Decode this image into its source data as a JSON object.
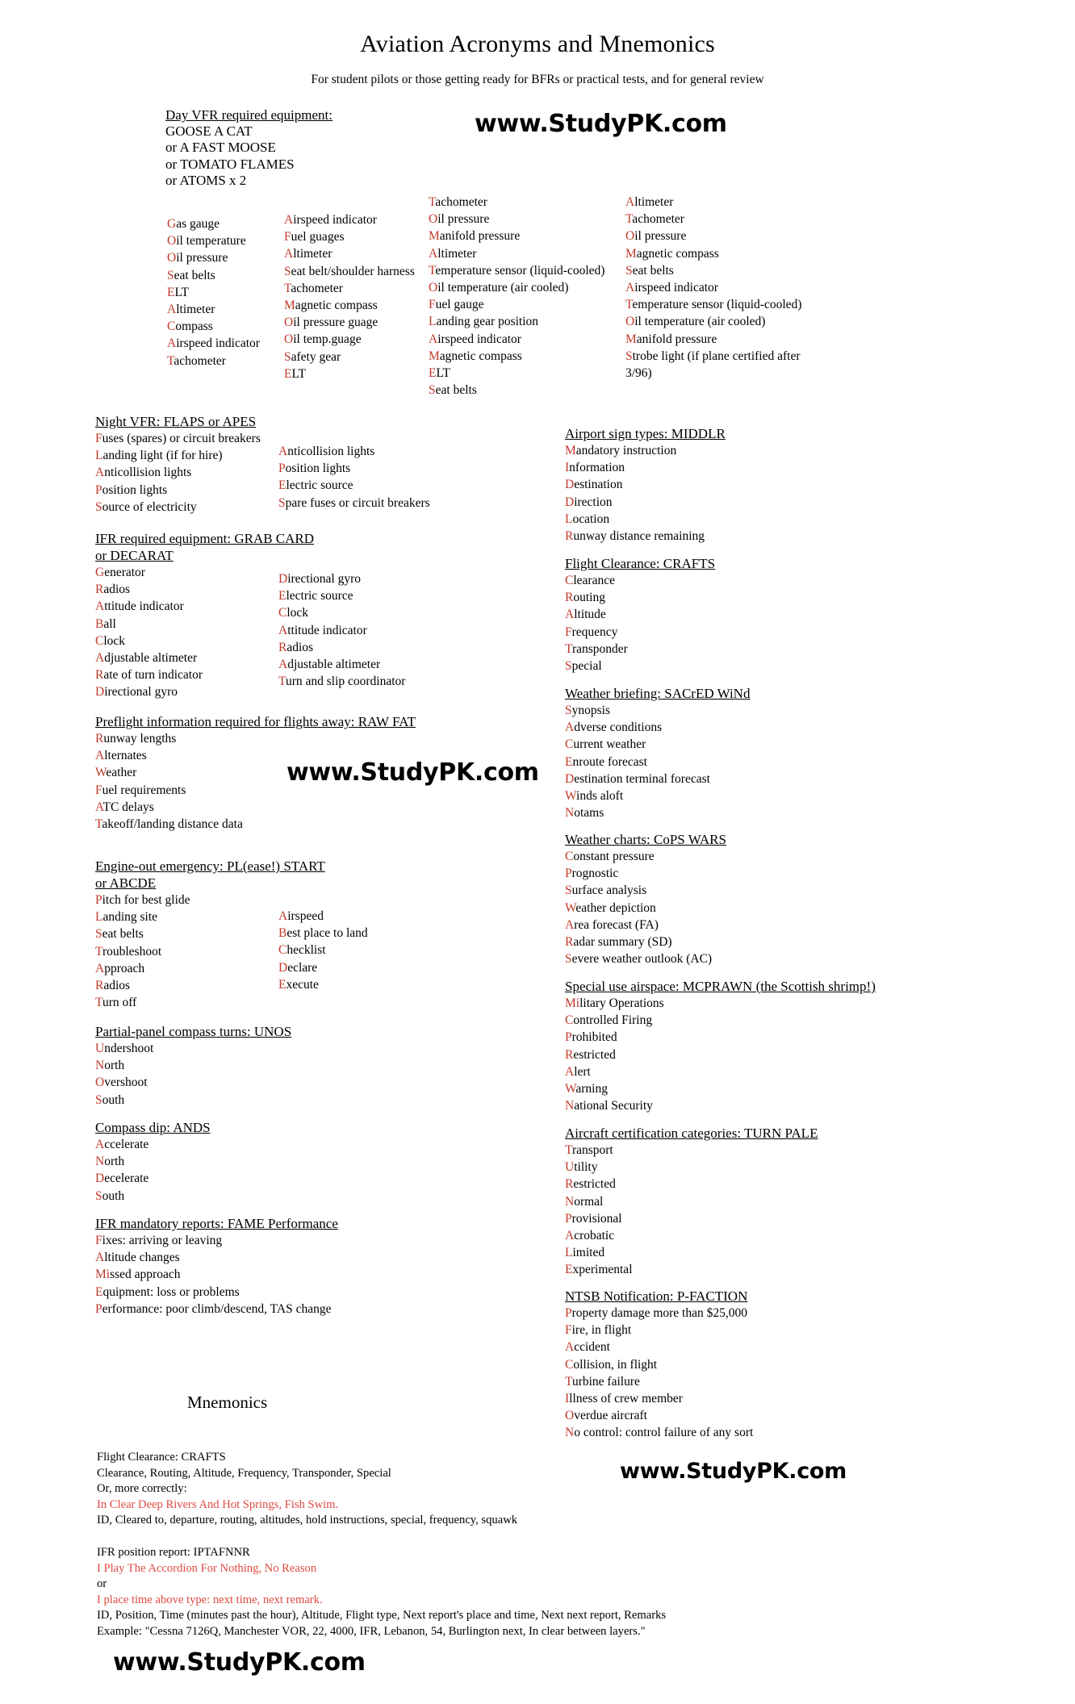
{
  "document": {
    "title": "Aviation Acronyms and Mnemonics",
    "subtitle": "For student pilots or those getting ready for BFRs or practical tests, and for general review"
  },
  "watermark": {
    "text": "www.StudyPK.com"
  },
  "day_vfr": {
    "heading": "Day VFR required equipment:",
    "acronyms": [
      "GOOSE A CAT",
      "or A FAST MOOSE",
      "or TOMATO FLAMES",
      "or ATOMS x 2"
    ],
    "columns": [
      {
        "name": "goose-a-cat",
        "items": [
          {
            "initial": "G",
            "rest": "as gauge"
          },
          {
            "initial": "O",
            "rest": "il temperature"
          },
          {
            "initial": "O",
            "rest": "il pressure"
          },
          {
            "initial": "S",
            "rest": "eat belts"
          },
          {
            "initial": "E",
            "rest": "LT"
          },
          {
            "initial": "A",
            "rest": "ltimeter"
          },
          {
            "initial": "C",
            "rest": "ompass"
          },
          {
            "initial": "A",
            "rest": "irspeed indicator"
          },
          {
            "initial": "T",
            "rest": "achometer"
          }
        ]
      },
      {
        "name": "a-fast-moose",
        "items": [
          {
            "initial": "A",
            "rest": "irspeed indicator"
          },
          {
            "initial": "F",
            "rest": "uel guages"
          },
          {
            "initial": "A",
            "rest": "ltimeter"
          },
          {
            "initial": "S",
            "rest": "eat belt/shoulder harness"
          },
          {
            "initial": "T",
            "rest": "achometer"
          },
          {
            "initial": "M",
            "rest": "agnetic compass"
          },
          {
            "initial": "O",
            "rest": "il pressure guage"
          },
          {
            "initial": "O",
            "rest": "il temp.guage"
          },
          {
            "initial": "S",
            "rest": "afety gear"
          },
          {
            "initial": "E",
            "rest": "LT"
          }
        ]
      },
      {
        "name": "tomato-flames",
        "items": [
          {
            "initial": "T",
            "rest": "achometer"
          },
          {
            "initial": "O",
            "rest": "il pressure"
          },
          {
            "initial": "M",
            "rest": "anifold pressure"
          },
          {
            "initial": "A",
            "rest": "ltimeter"
          },
          {
            "initial": "T",
            "rest": "emperature sensor (liquid-cooled)"
          },
          {
            "initial": "O",
            "rest": "il temperature (air cooled)"
          },
          {
            "initial": "F",
            "rest": "uel gauge"
          },
          {
            "initial": "L",
            "rest": "anding gear position"
          },
          {
            "initial": "A",
            "rest": "irspeed indicator"
          },
          {
            "initial": "M",
            "rest": "agnetic compass"
          },
          {
            "initial": "E",
            "rest": "LT"
          },
          {
            "initial": "S",
            "rest": "eat belts"
          }
        ]
      },
      {
        "name": "atoms-x-2",
        "items": [
          {
            "initial": "A",
            "rest": "ltimeter"
          },
          {
            "initial": "T",
            "rest": "achometer"
          },
          {
            "initial": "O",
            "rest": "il pressure"
          },
          {
            "initial": "M",
            "rest": "agnetic compass"
          },
          {
            "initial": "S",
            "rest": "eat belts"
          },
          {
            "initial": "A",
            "rest": "irspeed indicator"
          },
          {
            "initial": "T",
            "rest": "emperature sensor (liquid-cooled)"
          },
          {
            "initial": "O",
            "rest": "il temperature (air cooled)"
          },
          {
            "initial": "M",
            "rest": "anifold pressure"
          },
          {
            "initial": "S",
            "rest": "trobe light (if plane certified after 3/96)"
          }
        ]
      }
    ]
  },
  "night_vfr": {
    "heading": "Night VFR: FLAPS or APES",
    "columns": [
      {
        "name": "flaps",
        "items": [
          {
            "initial": "F",
            "rest": "uses (spares) or circuit breakers"
          },
          {
            "initial": "L",
            "rest": "anding light (if for hire)"
          },
          {
            "initial": "A",
            "rest": "nticollision lights"
          },
          {
            "initial": "P",
            "rest": "osition lights"
          },
          {
            "initial": "S",
            "rest": "ource of electricity"
          }
        ]
      },
      {
        "name": "apes",
        "items": [
          {
            "initial": "A",
            "rest": "nticollision lights"
          },
          {
            "initial": "P",
            "rest": "osition lights"
          },
          {
            "initial": "E",
            "rest": "lectric source"
          },
          {
            "initial": "S",
            "rest": "pare fuses or circuit breakers"
          }
        ]
      }
    ]
  },
  "ifr_equipment": {
    "heading_line1": "IFR required equipment: GRAB CARD",
    "heading_line2": "or DECARAT",
    "columns": [
      {
        "name": "grab-card",
        "items": [
          {
            "initial": "G",
            "rest": "enerator"
          },
          {
            "initial": "R",
            "rest": "adios"
          },
          {
            "initial": "A",
            "rest": "ttitude indicator"
          },
          {
            "initial": "B",
            "rest": "all"
          },
          {
            "initial": "C",
            "rest": "lock"
          },
          {
            "initial": "A",
            "rest": "djustable altimeter"
          },
          {
            "initial": "R",
            "rest": "ate of turn indicator"
          },
          {
            "initial": "D",
            "rest": "irectional gyro"
          }
        ]
      },
      {
        "name": "decarat",
        "items": [
          {
            "initial": "D",
            "rest": "irectional gyro"
          },
          {
            "initial": "E",
            "rest": "lectric source"
          },
          {
            "initial": "C",
            "rest": "lock"
          },
          {
            "initial": "A",
            "rest": "ttitude indicator"
          },
          {
            "initial": "R",
            "rest": "adios"
          },
          {
            "initial": "A",
            "rest": "djustable altimeter"
          },
          {
            "initial": "T",
            "rest": "urn and slip coordinator"
          }
        ]
      }
    ]
  },
  "preflight": {
    "heading": "Preflight information required for flights away: RAW FAT",
    "items": [
      {
        "initial": "R",
        "rest": "unway lengths"
      },
      {
        "initial": "A",
        "rest": "lternates"
      },
      {
        "initial": "W",
        "rest": "eather"
      },
      {
        "initial": "F",
        "rest": "uel requirements"
      },
      {
        "initial": "A",
        "rest": "TC delays"
      },
      {
        "initial": "T",
        "rest": "akeoff/landing distance data"
      }
    ]
  },
  "engine_out": {
    "heading_line1": "Engine-out emergency: PL(ease!) START",
    "heading_line2": "or ABCDE",
    "columns": [
      {
        "name": "pl-start",
        "items": [
          {
            "initial": "P",
            "rest": "itch for best glide"
          },
          {
            "initial": "L",
            "rest": "anding site"
          },
          {
            "initial": "S",
            "rest": "eat belts"
          },
          {
            "initial": "T",
            "rest": "roubleshoot"
          },
          {
            "initial": "A",
            "rest": "pproach"
          },
          {
            "initial": "R",
            "rest": "adios"
          },
          {
            "initial": "T",
            "rest": "urn off"
          }
        ]
      },
      {
        "name": "abcde",
        "items": [
          {
            "initial": "A",
            "rest": "irspeed"
          },
          {
            "initial": "B",
            "rest": "est place to land"
          },
          {
            "initial": "C",
            "rest": "hecklist"
          },
          {
            "initial": "D",
            "rest": "eclare"
          },
          {
            "initial": "E",
            "rest": "xecute"
          }
        ]
      }
    ]
  },
  "compass_turns": {
    "heading": "Partial-panel compass turns: UNOS",
    "items": [
      {
        "initial": "U",
        "rest": "ndershoot"
      },
      {
        "initial": "N",
        "rest": "orth"
      },
      {
        "initial": "O",
        "rest": "vershoot"
      },
      {
        "initial": "S",
        "rest": "outh"
      }
    ]
  },
  "compass_dip": {
    "heading": "Compass dip: ANDS",
    "items": [
      {
        "initial": "A",
        "rest": "ccelerate"
      },
      {
        "initial": "N",
        "rest": "orth"
      },
      {
        "initial": "D",
        "rest": "ecelerate"
      },
      {
        "initial": "S",
        "rest": "outh"
      }
    ]
  },
  "ifr_reports": {
    "heading": "IFR mandatory reports: FAME Performance",
    "items": [
      {
        "initial": "F",
        "rest": "ixes: arriving or leaving"
      },
      {
        "initial": "A",
        "rest": "ltitude changes"
      },
      {
        "initial": "Mi",
        "rest": "ssed approach"
      },
      {
        "initial": "E",
        "rest": "quipment: loss or problems"
      },
      {
        "initial": "P",
        "rest": "erformance: poor climb/descend, TAS change"
      }
    ]
  },
  "airport_signs": {
    "heading": "Airport sign types: MIDDLR",
    "items": [
      {
        "initial": "M",
        "rest": "andatory instruction"
      },
      {
        "initial": "I",
        "rest": "nformation"
      },
      {
        "initial": "D",
        "rest": "estination"
      },
      {
        "initial": "D",
        "rest": "irection"
      },
      {
        "initial": "L",
        "rest": "ocation"
      },
      {
        "initial": "R",
        "rest": "unway distance remaining"
      }
    ]
  },
  "flight_clearance": {
    "heading": "Flight Clearance: CRAFTS ",
    "items": [
      {
        "initial": "C",
        "rest": "learance"
      },
      {
        "initial": "R",
        "rest": "outing"
      },
      {
        "initial": "A",
        "rest": "ltitude"
      },
      {
        "initial": "F",
        "rest": "requency"
      },
      {
        "initial": "T",
        "rest": "ransponder"
      },
      {
        "initial": "S",
        "rest": "pecial"
      }
    ]
  },
  "weather_briefing": {
    "heading": "Weather briefing: SACrED WiNd",
    "items": [
      {
        "initial": "S",
        "rest": "ynopsis"
      },
      {
        "initial": "A",
        "rest": "dverse conditions"
      },
      {
        "initial": "C",
        "rest": "urrent weather"
      },
      {
        "initial": "E",
        "rest": "nroute forecast"
      },
      {
        "initial": "D",
        "rest": "estination terminal forecast"
      },
      {
        "initial": "W",
        "rest": "inds aloft"
      },
      {
        "initial": "N",
        "rest": "otams"
      }
    ]
  },
  "weather_charts": {
    "heading": "Weather charts: CoPS WARS",
    "items": [
      {
        "initial": "C",
        "rest": "onstant pressure"
      },
      {
        "initial": "P",
        "rest": "rognostic"
      },
      {
        "initial": "S",
        "rest": "urface analysis"
      },
      {
        "initial": "W",
        "rest": "eather depiction"
      },
      {
        "initial": "A",
        "rest": "rea forecast (FA)"
      },
      {
        "initial": "R",
        "rest": "adar summary (SD)"
      },
      {
        "initial": "S",
        "rest": "evere weather outlook (AC)"
      }
    ]
  },
  "special_use_airspace": {
    "heading": "Special use airspace: MCPRAWN (the Scottish shrimp!)",
    "items": [
      {
        "initial": "Mi",
        "rest": "litary Operations"
      },
      {
        "initial": "C",
        "rest": "ontrolled Firing"
      },
      {
        "initial": "P",
        "rest": "rohibited"
      },
      {
        "initial": "R",
        "rest": "estricted"
      },
      {
        "initial": "A",
        "rest": "lert"
      },
      {
        "initial": "W",
        "rest": "arning"
      },
      {
        "initial": "N",
        "rest": "ational Security"
      }
    ]
  },
  "certification_categories": {
    "heading": "Aircraft certification categories: TURN PALE",
    "items": [
      {
        "initial": "T",
        "rest": "ransport"
      },
      {
        "initial": "U",
        "rest": "tility"
      },
      {
        "initial": "R",
        "rest": "estricted"
      },
      {
        "initial": "N",
        "rest": "ormal"
      },
      {
        "initial": "P",
        "rest": "rovisional"
      },
      {
        "initial": "A",
        "rest": "crobatic"
      },
      {
        "initial": "L",
        "rest": "imited"
      },
      {
        "initial": "E",
        "rest": "xperimental"
      }
    ]
  },
  "ntsb": {
    "heading": "NTSB Notification: P-FACTION",
    "items": [
      {
        "initial": "P",
        "rest": "roperty damage more than $25,000"
      },
      {
        "initial": "F",
        "rest": "ire, in flight"
      },
      {
        "initial": "A",
        "rest": "ccident"
      },
      {
        "initial": "C",
        "rest": "ollision, in flight"
      },
      {
        "initial": "T",
        "rest": "urbine failure"
      },
      {
        "initial": "I",
        "rest": "llness of crew member"
      },
      {
        "initial": "O",
        "rest": "verdue aircraft"
      },
      {
        "initial": "N",
        "rest": "o control: control failure of any sort"
      }
    ]
  },
  "mnemonics_section": {
    "title": "Mnemonics",
    "crafts": {
      "line1": "Flight Clearance: CRAFTS",
      "line2": "Clearance, Routing, Altitude, Frequency, Transponder, Special",
      "line3": "Or, more correctly:",
      "line4_red": "In Clear Deep Rivers And Hot Springs, Fish Swim.",
      "line5": "ID, Cleared to, departure, routing, altitudes, hold instructions, special, frequency, squawk"
    },
    "iptafnnr": {
      "line1": "IFR position report: IPTAFNNR",
      "line2_red": "I Play The Accordion For Nothing, No Reason",
      "line3": "or",
      "line4_red": "I place time above type: next time, next remark.",
      "line5": "ID, Position, Time (minutes past the hour), Altitude, Flight type, Next report's place and time, Next next report, Remarks",
      "line6": "Example: \"Cessna 7126Q, Manchester VOR, 22, 4000, IFR, Lebanon, 54, Burlington next, In clear between layers.\""
    }
  }
}
